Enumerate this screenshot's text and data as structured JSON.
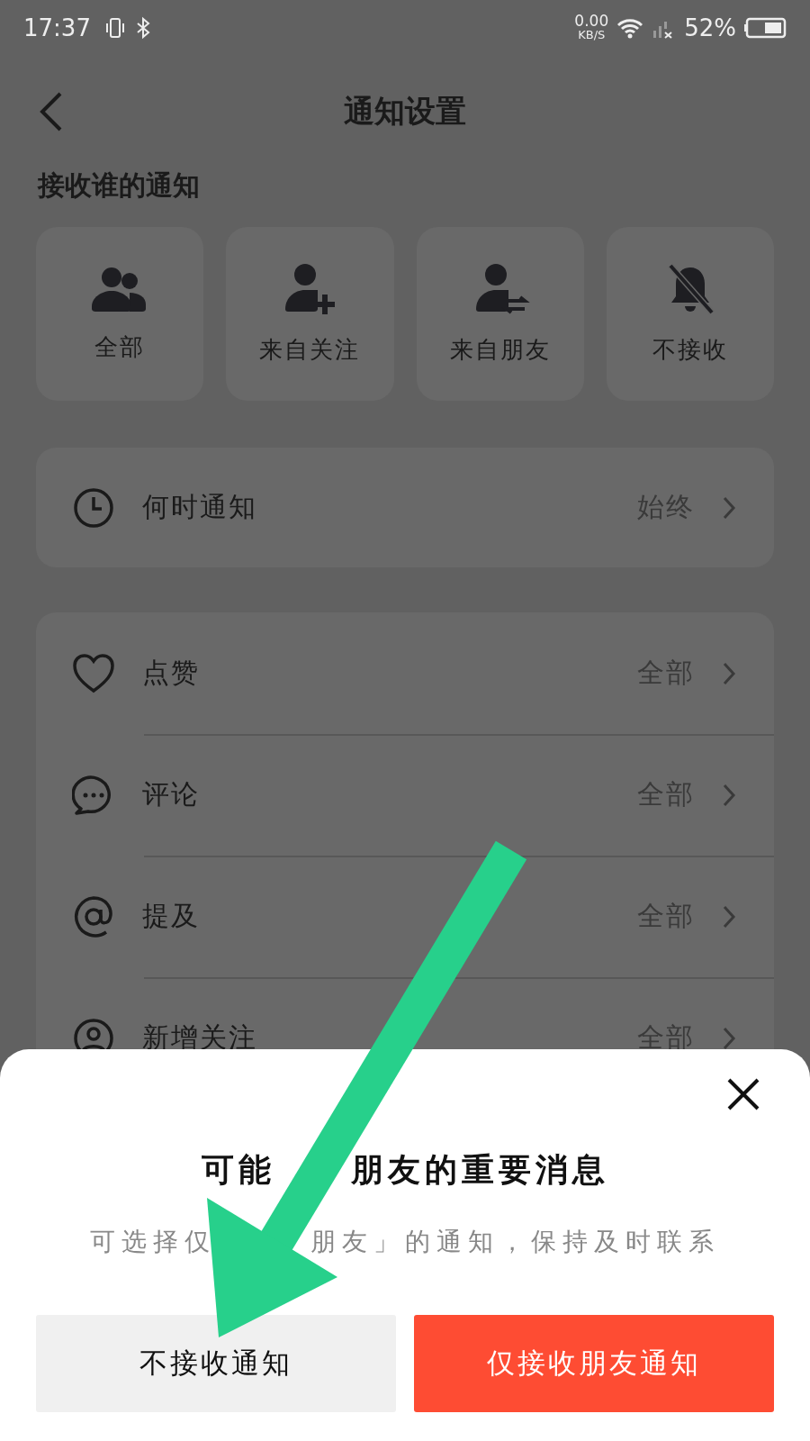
{
  "status_bar": {
    "time": "17:37",
    "net_speed": "0.00",
    "net_unit": "KB/S",
    "battery": "52%"
  },
  "header": {
    "title": "通知设置"
  },
  "section_label": "接收谁的通知",
  "audience_options": [
    {
      "label": "全部",
      "kind": "all"
    },
    {
      "label": "来自关注",
      "kind": "following"
    },
    {
      "label": "来自朋友",
      "kind": "friends"
    },
    {
      "label": "不接收",
      "kind": "none"
    }
  ],
  "when_row": {
    "label": "何时通知",
    "value": "始终"
  },
  "type_rows": [
    {
      "label": "点赞",
      "value": "全部",
      "kind": "like"
    },
    {
      "label": "评论",
      "value": "全部",
      "kind": "comment"
    },
    {
      "label": "提及",
      "value": "全部",
      "kind": "mention"
    },
    {
      "label": "新增关注",
      "value": "全部",
      "kind": "follow"
    }
  ],
  "sheet": {
    "title_parts": [
      "可能",
      "朋友的重要消息"
    ],
    "subtitle_parts": [
      "可选择仅",
      "朋友」的通知，保持及时联系"
    ],
    "buttons": [
      {
        "label": "不接收通知",
        "kind": "secondary"
      },
      {
        "label": "仅接收朋友通知",
        "kind": "primary"
      }
    ]
  }
}
